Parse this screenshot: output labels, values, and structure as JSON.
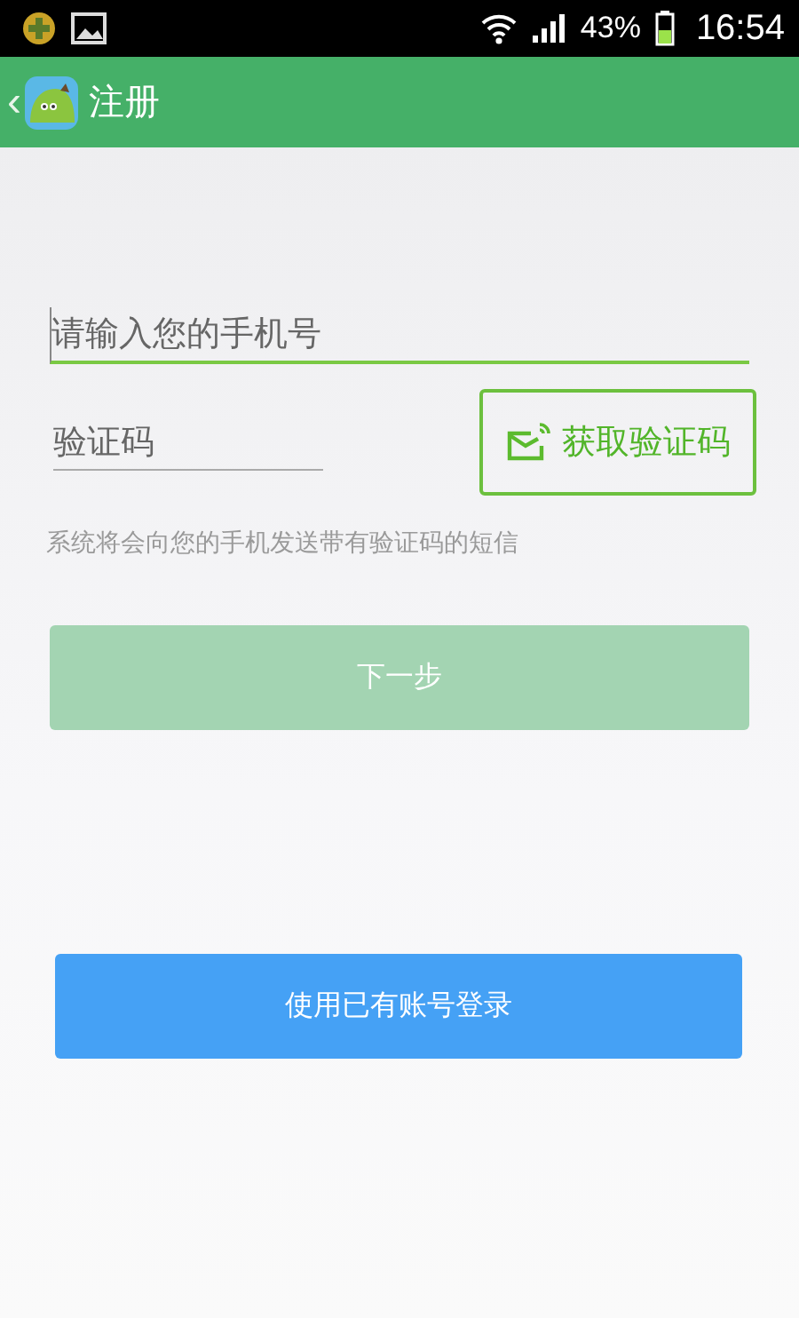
{
  "status_bar": {
    "battery": "43%",
    "time": "16:54"
  },
  "app_bar": {
    "back": "‹",
    "title": "注册"
  },
  "phone_field": {
    "placeholder": "请输入您的手机号",
    "focused": true
  },
  "code_field": {
    "placeholder": "验证码",
    "focused": false
  },
  "get_code_button": {
    "label": "获取验证码"
  },
  "hint": "系统将会向您的手机发送带有验证码的短信",
  "next_button": {
    "label": "下一步",
    "disabled": true
  },
  "login_button": {
    "label": "使用已有账号登录"
  }
}
